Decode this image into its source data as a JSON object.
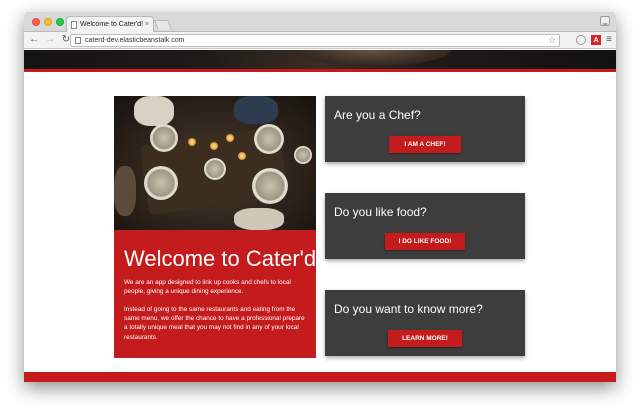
{
  "browser": {
    "tab_title": "Welcome to Cater'd!",
    "tab_close": "×",
    "url": "caterd-dev.elasticbeanstalk.com",
    "ext_label": "A"
  },
  "welcome": {
    "title": "Welcome to Cater'd!",
    "paragraph_1": "We are an app designed to link up cooks and chefs to local people, giving a unique dining experience.",
    "paragraph_2": "Instead of going to the same restaurants and eating from the same menu, we offer the chance to have a professional prepare a totally unique meal that you may not find in any of your local restaurants."
  },
  "cards": [
    {
      "question": "Are you a Chef?",
      "button": "I AM A CHEF!"
    },
    {
      "question": "Do you like food?",
      "button": "I DO LIKE FOOD!"
    },
    {
      "question": "Do you want to know more?",
      "button": "LEARN MORE!"
    }
  ],
  "icons": {
    "back": "back-arrow-icon",
    "forward": "forward-arrow-icon",
    "reload": "reload-icon",
    "star": "star-icon",
    "menu": "hamburger-menu-icon"
  },
  "colors": {
    "brand_red": "#c41b1c",
    "card_bg": "#3d3d3d",
    "hero_dark": "#141414"
  }
}
